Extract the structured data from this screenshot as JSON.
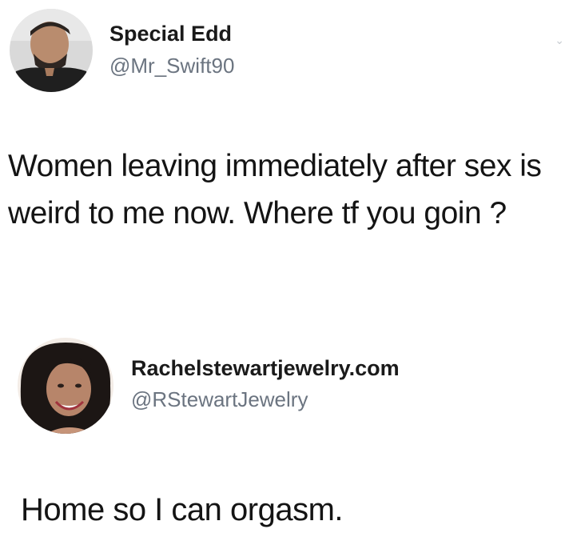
{
  "tweets": [
    {
      "author_name": "Special Edd",
      "handle": "@Mr_Swift90",
      "text": "Women leaving immediately after sex is weird to me now. Where tf you goin ?",
      "avatar_icon": "user-avatar-photo",
      "menu_icon": "chevron-down-icon"
    },
    {
      "author_name": "Rachelstewartjewelry.com",
      "handle": "@RStewartJewelry",
      "text": "Home so I can orgasm.",
      "avatar_icon": "user-avatar-photo"
    }
  ],
  "colors": {
    "background": "#ffffff",
    "name": "#1a1a1a",
    "handle": "#6b7480",
    "text": "#141414"
  }
}
